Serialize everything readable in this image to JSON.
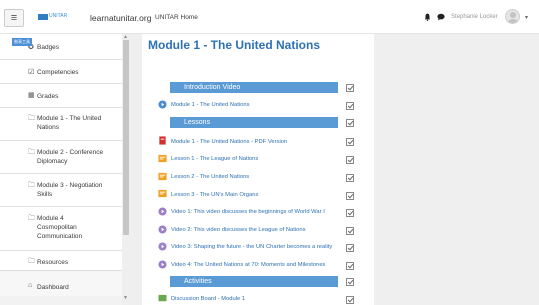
{
  "navbar": {
    "menu_icon": "hamburger-icon",
    "logo_text": "UNITAR",
    "site_name": "learnatunitar.org",
    "home_link": "UNITAR Home",
    "bell_icon": "bell-icon",
    "chat_icon": "chat-icon",
    "user_name": "Stephanie Locker",
    "caret": "▾"
  },
  "sidebar": {
    "tag": "制表工具",
    "items": [
      {
        "icon": "badge-icon",
        "label": "Badges"
      },
      {
        "icon": "checkbox-icon",
        "label": "Competencies"
      },
      {
        "icon": "grid-icon",
        "label": "Grades"
      },
      {
        "icon": "folder-icon",
        "label": "Module 1 - The United Nations"
      },
      {
        "icon": "folder-icon",
        "label": "Module 2 - Conference Diplomacy"
      },
      {
        "icon": "folder-icon",
        "label": "Module 3 - Negotiation Skills"
      },
      {
        "icon": "folder-icon",
        "label": "Module 4 Cosmopolitan Communication"
      },
      {
        "icon": "folder-icon",
        "label": "Resources"
      }
    ],
    "dashboard": {
      "icon": "dashboard-icon",
      "label": "Dashboard"
    }
  },
  "main": {
    "title": "Module 1 - The United Nations",
    "sections": {
      "intro": "Introduction Video",
      "lessons": "Lessons",
      "activities": "Activities"
    },
    "activities": [
      {
        "type": "video",
        "label": "Module 1 - The United Nations"
      },
      {
        "type": "pdf",
        "label": "Module 1 - The United Nations - PDF Version"
      },
      {
        "type": "lesson",
        "label": "Lesson 1 - The League of Nations"
      },
      {
        "type": "lesson",
        "label": "Lesson 2 - The United Nations"
      },
      {
        "type": "lesson",
        "label": "Lesson 3 - The UN's Main Organs"
      },
      {
        "type": "video",
        "label": "Video 1: This video discusses the beginnings of World War I"
      },
      {
        "type": "video",
        "label": "Video 2: This video discusses the League of Nations"
      },
      {
        "type": "video",
        "label": "Video 3: Shaping the future - the UN Charter becomes a reality"
      },
      {
        "type": "video",
        "label": "Video 4: The United Nations at 70: Moments and Milestones"
      },
      {
        "type": "forum",
        "label": "Discussion Board - Module 1"
      }
    ]
  },
  "colors": {
    "accent": "#2e71b5",
    "section_bar": "#5b9bd5",
    "sidebar_bg": "#f2f2f2"
  }
}
